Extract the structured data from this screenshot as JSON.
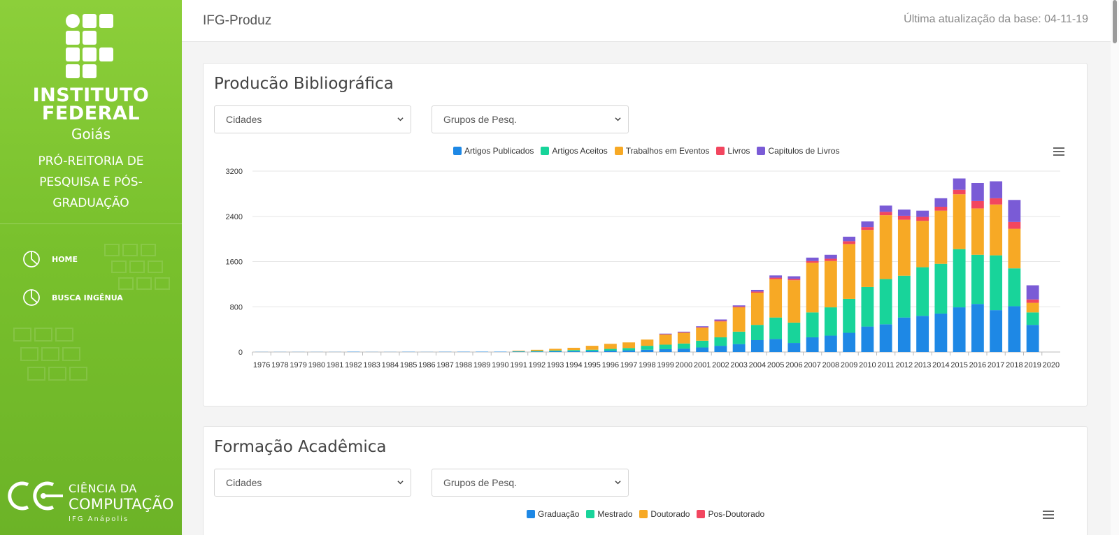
{
  "sidebar": {
    "inst_line1": "INSTITUTO",
    "inst_line2": "FEDERAL",
    "inst_sub": "Goiás",
    "prorei_line1": "PRÓ-REITORIA DE",
    "prorei_line2": "PESQUISA E PÓS-",
    "prorei_line3": "GRADUAÇÃO",
    "nav": [
      {
        "label": "HOME",
        "icon": "pie-chart-icon"
      },
      {
        "label": "BUSCA INGÊNUA",
        "icon": "pie-chart-icon"
      }
    ],
    "footer_logo": {
      "line1": "CIÊNCIA DA",
      "line2": "COMPUTAÇÃO",
      "line3": "IFG Anápolis"
    }
  },
  "topbar": {
    "app_name": "IFG-Produz",
    "update_text": "Última atualização da base: 04-11-19"
  },
  "cards": [
    {
      "title": "Producão Bibliográfica",
      "select_city": "Cidades",
      "select_group": "Grupos de Pesq."
    },
    {
      "title": "Formação Acadêmica",
      "select_city": "Cidades",
      "select_group": "Grupos de Pesq.",
      "legend": [
        {
          "name": "Graduação",
          "color": "#1e88e5"
        },
        {
          "name": "Mestrado",
          "color": "#18d49a"
        },
        {
          "name": "Doutorado",
          "color": "#f7a925"
        },
        {
          "name": "Pos-Doutorado",
          "color": "#f2465f"
        }
      ]
    }
  ],
  "colors": {
    "sidebar_green": "#79c12d"
  },
  "chart_data": {
    "type": "bar",
    "stacked": true,
    "categories": [
      "1976",
      "1978",
      "1979",
      "1980",
      "1981",
      "1982",
      "1983",
      "1984",
      "1985",
      "1986",
      "1987",
      "1988",
      "1989",
      "1990",
      "1991",
      "1992",
      "1993",
      "1994",
      "1995",
      "1996",
      "1997",
      "1998",
      "1999",
      "2000",
      "2001",
      "2002",
      "2003",
      "2004",
      "2005",
      "2006",
      "2007",
      "2008",
      "2009",
      "2010",
      "2011",
      "2012",
      "2013",
      "2014",
      "2015",
      "2016",
      "2017",
      "2018",
      "2019",
      "2020"
    ],
    "series": [
      {
        "name": "Artigos Publicados",
        "color": "#1e88e5",
        "values": [
          2,
          2,
          2,
          2,
          2,
          5,
          2,
          2,
          4,
          2,
          4,
          5,
          6,
          6,
          8,
          9,
          12,
          15,
          20,
          25,
          30,
          40,
          50,
          60,
          80,
          110,
          140,
          210,
          230,
          160,
          260,
          290,
          340,
          450,
          490,
          610,
          640,
          680,
          790,
          850,
          740,
          810,
          480,
          0
        ]
      },
      {
        "name": "Artigos Aceitos",
        "color": "#18d49a",
        "values": [
          0,
          0,
          0,
          0,
          0,
          0,
          0,
          0,
          0,
          0,
          0,
          0,
          0,
          0,
          5,
          10,
          15,
          20,
          20,
          30,
          40,
          70,
          80,
          90,
          120,
          150,
          220,
          270,
          380,
          360,
          440,
          500,
          600,
          700,
          800,
          740,
          860,
          880,
          1030,
          870,
          970,
          670,
          220,
          0
        ]
      },
      {
        "name": "Trabalhos em Eventos",
        "color": "#f7a925",
        "values": [
          0,
          0,
          0,
          0,
          0,
          0,
          0,
          0,
          0,
          0,
          0,
          0,
          0,
          0,
          10,
          20,
          30,
          40,
          70,
          90,
          100,
          110,
          180,
          190,
          230,
          280,
          430,
          570,
          680,
          750,
          880,
          820,
          970,
          1010,
          1130,
          990,
          820,
          940,
          970,
          820,
          900,
          700,
          170,
          0
        ]
      },
      {
        "name": "Livros",
        "color": "#f2465f",
        "values": [
          0,
          0,
          0,
          0,
          0,
          0,
          0,
          0,
          0,
          0,
          0,
          0,
          0,
          0,
          0,
          0,
          0,
          0,
          0,
          0,
          0,
          0,
          5,
          8,
          10,
          15,
          15,
          20,
          25,
          25,
          30,
          40,
          50,
          50,
          60,
          70,
          70,
          70,
          80,
          130,
          110,
          120,
          60,
          0
        ]
      },
      {
        "name": "Capitulos de Livros",
        "color": "#7a5bd6",
        "values": [
          0,
          0,
          0,
          0,
          0,
          0,
          0,
          0,
          0,
          0,
          0,
          0,
          0,
          0,
          0,
          0,
          0,
          0,
          0,
          0,
          0,
          0,
          10,
          12,
          15,
          20,
          20,
          30,
          40,
          45,
          60,
          70,
          80,
          100,
          110,
          110,
          110,
          150,
          200,
          320,
          300,
          390,
          250,
          0
        ]
      }
    ],
    "ylim": [
      0,
      3200
    ],
    "yticks": [
      0,
      800,
      1600,
      2400,
      3200
    ],
    "legend_position": "top-center",
    "grid": true
  }
}
